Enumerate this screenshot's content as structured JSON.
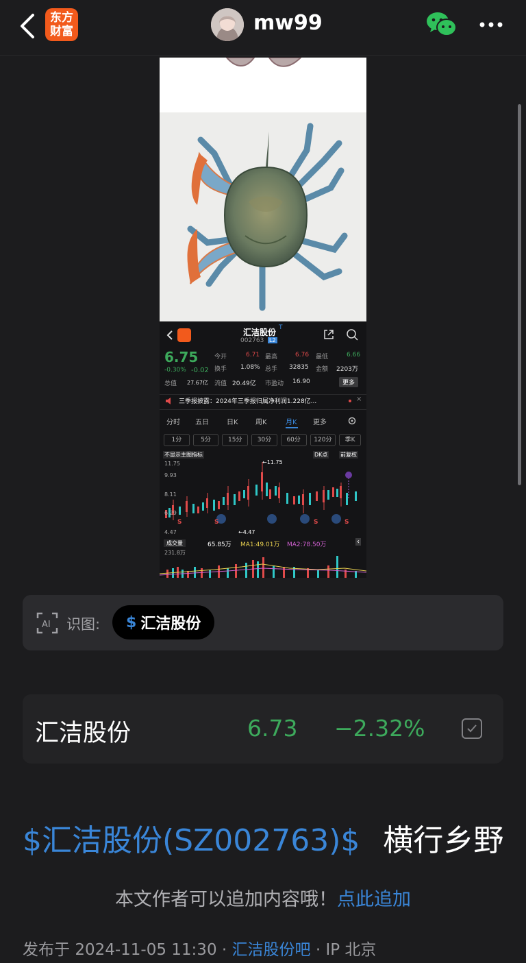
{
  "header": {
    "logo_text_line1": "东方",
    "logo_text_line2": "财富",
    "username": "mw99",
    "icons": [
      "back-chevron-icon",
      "wechat-icon",
      "more-dots-icon"
    ]
  },
  "stock_screenshot": {
    "name": "汇洁股份",
    "name_suffix": "T",
    "code": "002763",
    "level_badge": "L2",
    "price": "6.75",
    "change_pct": "-0.30%",
    "change_amt": "-0.02",
    "stats": [
      {
        "label": "今开",
        "value": "6.71"
      },
      {
        "label": "最高",
        "value": "6.76"
      },
      {
        "label": "最低",
        "value": "6.66"
      },
      {
        "label": "换手",
        "value": "1.08%"
      },
      {
        "label": "总手",
        "value": "32835"
      },
      {
        "label": "金额",
        "value": "2203万"
      },
      {
        "label": "总值",
        "value": "27.67亿"
      },
      {
        "label": "流值",
        "value": "20.49亿"
      },
      {
        "label": "市盈动",
        "value": "16.90"
      }
    ],
    "more_btn": "更多",
    "announcement": "三季报披露：2024年三季报归属净利润1.228亿...",
    "period_tabs": [
      "分时",
      "五日",
      "日K",
      "周K",
      "月K",
      "更多"
    ],
    "active_period": "月K",
    "minute_tabs": [
      "1分",
      "5分",
      "15分",
      "30分",
      "60分",
      "120分",
      "季K"
    ],
    "indicator_btn": "不显示主图指标",
    "dk_btn": "DK点",
    "adjust_btn": "前复权",
    "y_labels": [
      "11.75",
      "9.93",
      "8.11",
      "6.29",
      "4.47"
    ],
    "high_marker": "←11.75",
    "low_marker": "←4.47",
    "volume_label": "成交量",
    "volume_value": "65.85万",
    "ma1": "MA1:49.01万",
    "ma2": "MA2:78.50万",
    "volume_axis": "231.8万"
  },
  "ocr": {
    "label": "识图:",
    "tag_symbol": "$",
    "tag_text": "汇洁股份"
  },
  "stock_card": {
    "name": "汇洁股份",
    "price": "6.73",
    "change": "−2.32%"
  },
  "post": {
    "stock_link": "$汇洁股份(SZ002763)$",
    "text": "横行乡野"
  },
  "notice": {
    "text": "本文作者可以追加内容哦！",
    "link": "点此追加"
  },
  "meta": {
    "prefix": "发布于",
    "datetime": "2024-11-05 11:30",
    "sep1": "·",
    "bar_link": "汇洁股份吧",
    "sep2": "·",
    "ip": "IP 北京"
  },
  "colors": {
    "background": "#1c1c1e",
    "link_blue": "#3a86d8",
    "down_green": "#3daa5c",
    "brand_orange": "#f25a1c"
  }
}
